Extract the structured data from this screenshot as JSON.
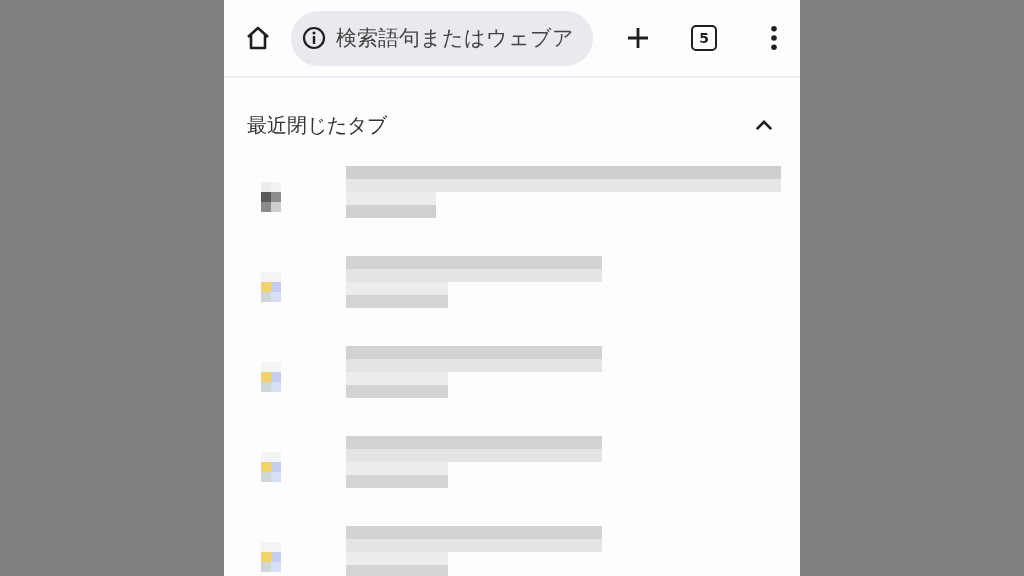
{
  "toolbar": {
    "address_placeholder": "検索語句またはウェブア",
    "tab_count": "5"
  },
  "section": {
    "title": "最近閉じたタブ",
    "expanded": true
  },
  "items": [
    {
      "kind": "dark"
    },
    {
      "kind": "tile"
    },
    {
      "kind": "tile"
    },
    {
      "kind": "tile"
    },
    {
      "kind": "tile"
    }
  ]
}
